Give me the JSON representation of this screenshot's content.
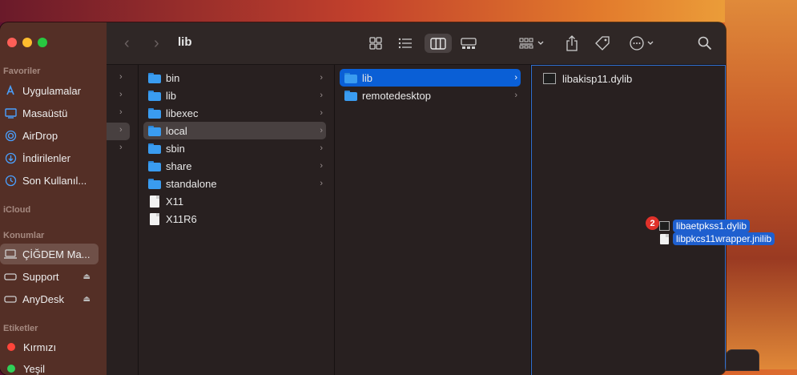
{
  "window": {
    "title": "lib"
  },
  "sidebar": {
    "sections": {
      "favorites": "Favoriler",
      "icloud": "iCloud",
      "locations": "Konumlar",
      "tags": "Etiketler"
    },
    "favorites": [
      {
        "label": "Uygulamalar",
        "icon": "applications-icon"
      },
      {
        "label": "Masaüstü",
        "icon": "desktop-icon"
      },
      {
        "label": "AirDrop",
        "icon": "airdrop-icon"
      },
      {
        "label": "İndirilenler",
        "icon": "downloads-icon"
      },
      {
        "label": "Son Kullanıl...",
        "icon": "recents-icon"
      }
    ],
    "locations": [
      {
        "label": "ÇİĞDEM Ma...",
        "icon": "laptop-icon"
      },
      {
        "label": "Support",
        "icon": "drive-icon"
      },
      {
        "label": "AnyDesk",
        "icon": "drive-icon"
      }
    ],
    "tags": [
      {
        "label": "Kırmızı",
        "color": "#ff453a"
      },
      {
        "label": "Yeşil",
        "color": "#30d158"
      }
    ]
  },
  "columns": {
    "col2": [
      {
        "name": "bin",
        "type": "folder"
      },
      {
        "name": "lib",
        "type": "folder"
      },
      {
        "name": "libexec",
        "type": "folder"
      },
      {
        "name": "local",
        "type": "folder"
      },
      {
        "name": "sbin",
        "type": "folder"
      },
      {
        "name": "share",
        "type": "folder"
      },
      {
        "name": "standalone",
        "type": "folder"
      },
      {
        "name": "X11",
        "type": "alias"
      },
      {
        "name": "X11R6",
        "type": "alias"
      }
    ],
    "col3": [
      {
        "name": "lib",
        "type": "folder"
      },
      {
        "name": "remotedesktop",
        "type": "folder"
      }
    ],
    "col4": [
      {
        "name": "libakisp11.dylib",
        "type": "exec"
      }
    ]
  },
  "drag": {
    "count": "2",
    "items": [
      "libaetpkss1.dylib",
      "libpkcs11wrapper.jnilib"
    ]
  }
}
